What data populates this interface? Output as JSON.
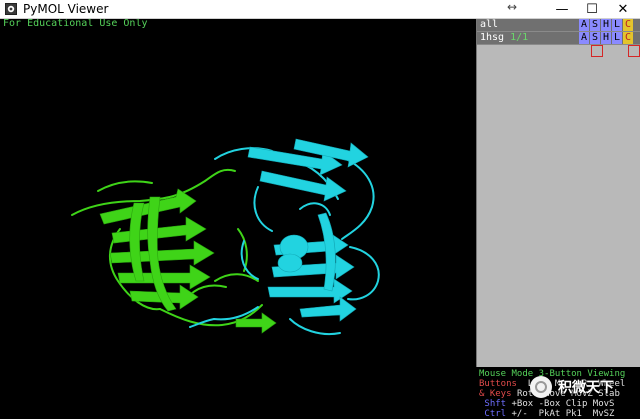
{
  "window": {
    "title": "PyMOL Viewer",
    "resize_glyph": "↔",
    "minimize": "—",
    "maximize": "☐",
    "close": "✕"
  },
  "viewport": {
    "education_note": "For Educational Use Only",
    "chain_colors": {
      "chain_a": "#3fd418",
      "chain_b": "#22d3e0"
    }
  },
  "objects": [
    {
      "name": "all",
      "state": "",
      "buttons": [
        "A",
        "S",
        "H",
        "L",
        "C"
      ]
    },
    {
      "name": "1hsg",
      "state": "1/1",
      "buttons": [
        "A",
        "S",
        "H",
        "L",
        "C"
      ]
    }
  ],
  "mouse_panel": {
    "line1_mode": "Mouse Mode",
    "line1_view": "3-Button Viewing",
    "line2_label": "Buttons",
    "line2_values": "  L    M    R  Wheel",
    "line3_label": "& Keys",
    "line3_values": "Rota Move MovZ Slab",
    "line4_label": " Shft",
    "line4_values": "+Box -Box Clip MovS",
    "line5_label": " Ctrl",
    "line5_values": "+/-  PkAt Pk1  MvSZ"
  },
  "watermark": {
    "text": "积微天下"
  },
  "colors": {
    "panel_bg": "#b9b9b9",
    "row_bg": "#707070",
    "button_blue": "#8a8aff",
    "button_c": "#e3c42c",
    "mouse_green": "#55d25a",
    "mouse_red": "#e04a4a",
    "mouse_blue": "#6e6eff"
  }
}
